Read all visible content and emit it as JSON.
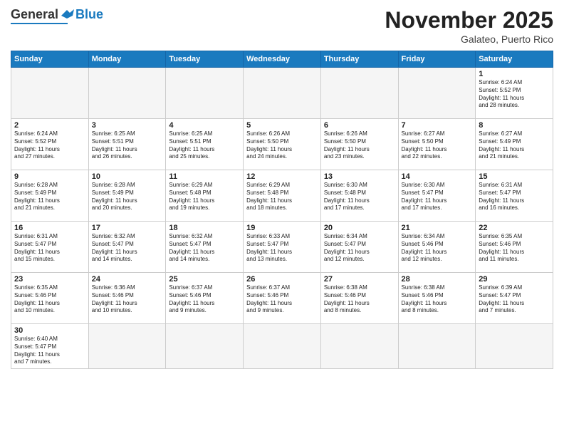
{
  "header": {
    "logo_general": "General",
    "logo_blue": "Blue",
    "month_title": "November 2025",
    "location": "Galateo, Puerto Rico"
  },
  "days_of_week": [
    "Sunday",
    "Monday",
    "Tuesday",
    "Wednesday",
    "Thursday",
    "Friday",
    "Saturday"
  ],
  "weeks": [
    [
      {
        "num": "",
        "info": "",
        "empty": true
      },
      {
        "num": "",
        "info": "",
        "empty": true
      },
      {
        "num": "",
        "info": "",
        "empty": true
      },
      {
        "num": "",
        "info": "",
        "empty": true
      },
      {
        "num": "",
        "info": "",
        "empty": true
      },
      {
        "num": "",
        "info": "",
        "empty": true
      },
      {
        "num": "1",
        "info": "Sunrise: 6:24 AM\nSunset: 5:52 PM\nDaylight: 11 hours\nand 28 minutes.",
        "empty": false
      }
    ],
    [
      {
        "num": "2",
        "info": "Sunrise: 6:24 AM\nSunset: 5:52 PM\nDaylight: 11 hours\nand 27 minutes.",
        "empty": false
      },
      {
        "num": "3",
        "info": "Sunrise: 6:25 AM\nSunset: 5:51 PM\nDaylight: 11 hours\nand 26 minutes.",
        "empty": false
      },
      {
        "num": "4",
        "info": "Sunrise: 6:25 AM\nSunset: 5:51 PM\nDaylight: 11 hours\nand 25 minutes.",
        "empty": false
      },
      {
        "num": "5",
        "info": "Sunrise: 6:26 AM\nSunset: 5:50 PM\nDaylight: 11 hours\nand 24 minutes.",
        "empty": false
      },
      {
        "num": "6",
        "info": "Sunrise: 6:26 AM\nSunset: 5:50 PM\nDaylight: 11 hours\nand 23 minutes.",
        "empty": false
      },
      {
        "num": "7",
        "info": "Sunrise: 6:27 AM\nSunset: 5:50 PM\nDaylight: 11 hours\nand 22 minutes.",
        "empty": false
      },
      {
        "num": "8",
        "info": "Sunrise: 6:27 AM\nSunset: 5:49 PM\nDaylight: 11 hours\nand 21 minutes.",
        "empty": false
      }
    ],
    [
      {
        "num": "9",
        "info": "Sunrise: 6:28 AM\nSunset: 5:49 PM\nDaylight: 11 hours\nand 21 minutes.",
        "empty": false
      },
      {
        "num": "10",
        "info": "Sunrise: 6:28 AM\nSunset: 5:49 PM\nDaylight: 11 hours\nand 20 minutes.",
        "empty": false
      },
      {
        "num": "11",
        "info": "Sunrise: 6:29 AM\nSunset: 5:48 PM\nDaylight: 11 hours\nand 19 minutes.",
        "empty": false
      },
      {
        "num": "12",
        "info": "Sunrise: 6:29 AM\nSunset: 5:48 PM\nDaylight: 11 hours\nand 18 minutes.",
        "empty": false
      },
      {
        "num": "13",
        "info": "Sunrise: 6:30 AM\nSunset: 5:48 PM\nDaylight: 11 hours\nand 17 minutes.",
        "empty": false
      },
      {
        "num": "14",
        "info": "Sunrise: 6:30 AM\nSunset: 5:47 PM\nDaylight: 11 hours\nand 17 minutes.",
        "empty": false
      },
      {
        "num": "15",
        "info": "Sunrise: 6:31 AM\nSunset: 5:47 PM\nDaylight: 11 hours\nand 16 minutes.",
        "empty": false
      }
    ],
    [
      {
        "num": "16",
        "info": "Sunrise: 6:31 AM\nSunset: 5:47 PM\nDaylight: 11 hours\nand 15 minutes.",
        "empty": false
      },
      {
        "num": "17",
        "info": "Sunrise: 6:32 AM\nSunset: 5:47 PM\nDaylight: 11 hours\nand 14 minutes.",
        "empty": false
      },
      {
        "num": "18",
        "info": "Sunrise: 6:32 AM\nSunset: 5:47 PM\nDaylight: 11 hours\nand 14 minutes.",
        "empty": false
      },
      {
        "num": "19",
        "info": "Sunrise: 6:33 AM\nSunset: 5:47 PM\nDaylight: 11 hours\nand 13 minutes.",
        "empty": false
      },
      {
        "num": "20",
        "info": "Sunrise: 6:34 AM\nSunset: 5:47 PM\nDaylight: 11 hours\nand 12 minutes.",
        "empty": false
      },
      {
        "num": "21",
        "info": "Sunrise: 6:34 AM\nSunset: 5:46 PM\nDaylight: 11 hours\nand 12 minutes.",
        "empty": false
      },
      {
        "num": "22",
        "info": "Sunrise: 6:35 AM\nSunset: 5:46 PM\nDaylight: 11 hours\nand 11 minutes.",
        "empty": false
      }
    ],
    [
      {
        "num": "23",
        "info": "Sunrise: 6:35 AM\nSunset: 5:46 PM\nDaylight: 11 hours\nand 10 minutes.",
        "empty": false
      },
      {
        "num": "24",
        "info": "Sunrise: 6:36 AM\nSunset: 5:46 PM\nDaylight: 11 hours\nand 10 minutes.",
        "empty": false
      },
      {
        "num": "25",
        "info": "Sunrise: 6:37 AM\nSunset: 5:46 PM\nDaylight: 11 hours\nand 9 minutes.",
        "empty": false
      },
      {
        "num": "26",
        "info": "Sunrise: 6:37 AM\nSunset: 5:46 PM\nDaylight: 11 hours\nand 9 minutes.",
        "empty": false
      },
      {
        "num": "27",
        "info": "Sunrise: 6:38 AM\nSunset: 5:46 PM\nDaylight: 11 hours\nand 8 minutes.",
        "empty": false
      },
      {
        "num": "28",
        "info": "Sunrise: 6:38 AM\nSunset: 5:46 PM\nDaylight: 11 hours\nand 8 minutes.",
        "empty": false
      },
      {
        "num": "29",
        "info": "Sunrise: 6:39 AM\nSunset: 5:47 PM\nDaylight: 11 hours\nand 7 minutes.",
        "empty": false
      }
    ],
    [
      {
        "num": "30",
        "info": "Sunrise: 6:40 AM\nSunset: 5:47 PM\nDaylight: 11 hours\nand 7 minutes.",
        "empty": false
      },
      {
        "num": "",
        "info": "",
        "empty": true
      },
      {
        "num": "",
        "info": "",
        "empty": true
      },
      {
        "num": "",
        "info": "",
        "empty": true
      },
      {
        "num": "",
        "info": "",
        "empty": true
      },
      {
        "num": "",
        "info": "",
        "empty": true
      },
      {
        "num": "",
        "info": "",
        "empty": true
      }
    ]
  ]
}
